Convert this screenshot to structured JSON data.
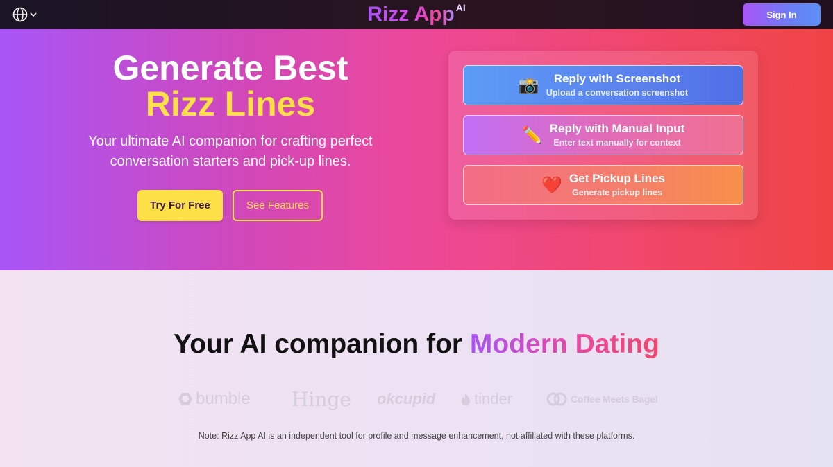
{
  "nav": {
    "language_icon": "globe-icon",
    "brand": "Rizz App",
    "brand_superscript": "AI",
    "sign_in": "Sign In"
  },
  "hero": {
    "title_line1": "Generate Best",
    "title_line2": "Rizz Lines",
    "subtitle": "Your ultimate AI companion for crafting perfect conversation starters and pick-up lines.",
    "try_button": "Try For Free",
    "features_button": "See Features",
    "options": [
      {
        "icon": "camera-icon",
        "glyph": "📸",
        "title": "Reply with Screenshot",
        "description": "Upload a conversation screenshot"
      },
      {
        "icon": "pencil-icon",
        "glyph": "✏️",
        "title": "Reply with Manual Input",
        "description": "Enter text manually for context"
      },
      {
        "icon": "heart-icon",
        "glyph": "❤️",
        "title": "Get Pickup Lines",
        "description": "Generate pickup lines"
      }
    ]
  },
  "companion": {
    "title_prefix": "Your AI companion for ",
    "title_highlight": "Modern Dating",
    "logos": [
      "bumble",
      "Hinge",
      "okcupid",
      "tinder",
      "Coffee Meets Bagel"
    ],
    "note": "Note: Rizz App AI is an independent tool for profile and message enhancement, not affiliated with these platforms."
  },
  "colors": {
    "accent_yellow": "#fde047",
    "accent_purple": "#a855f7",
    "accent_pink": "#ec4899",
    "accent_red": "#ef4444"
  }
}
